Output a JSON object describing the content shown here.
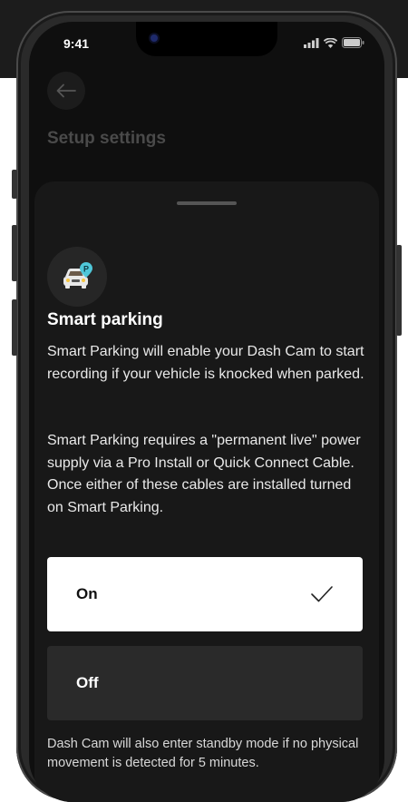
{
  "status_bar": {
    "time": "9:41"
  },
  "header": {
    "back_icon": "arrow-left-icon",
    "title": "Setup settings"
  },
  "sheet": {
    "icon": "car-parking-icon",
    "title": "Smart parking",
    "description_1": "Smart Parking will enable your Dash Cam to start recording if your vehicle is knocked when parked.",
    "description_2": "Smart Parking requires a \"permanent live\" power supply via a Pro Install or Quick Connect Cable. Once either of these cables are installed turned on Smart Parking.",
    "options": [
      {
        "label": "On",
        "selected": true
      },
      {
        "label": "Off",
        "selected": false
      }
    ],
    "footnote": "Dash Cam will also enter standby mode if no physical movement is detected for 5 minutes."
  },
  "colors": {
    "accent": "#4fc7d9",
    "sheet_bg": "#181818",
    "screen_bg": "#0f0f0f"
  }
}
